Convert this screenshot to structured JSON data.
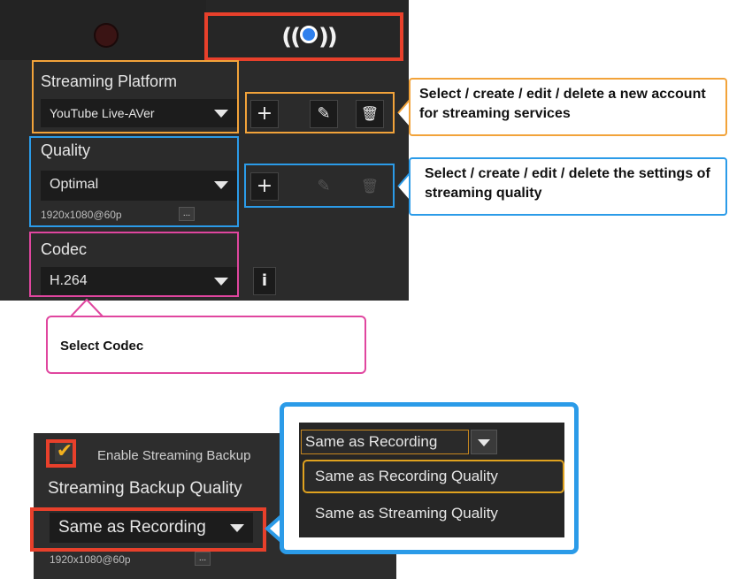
{
  "tabs": {
    "streaming_icon": "broadcast-icon"
  },
  "streaming_platform": {
    "label": "Streaming Platform",
    "value": "YouTube Live-AVer",
    "add": "+",
    "edit": "✎",
    "delete": "🗑"
  },
  "quality": {
    "label": "Quality",
    "value": "Optimal",
    "resolution": "1920x1080@60p",
    "more": "...",
    "add": "+",
    "edit": "✎",
    "delete": "🗑"
  },
  "codec": {
    "label": "Codec",
    "value": "H.264",
    "info": "i"
  },
  "callouts": {
    "platform": "Select / create / edit / delete a new account for streaming services",
    "quality": "Select / create / edit / delete the settings of streaming quality",
    "codec": "Select Codec"
  },
  "backup": {
    "checkbox_mark": "✔",
    "enable_label": "Enable Streaming Backup",
    "quality_label": "Streaming Backup Quality",
    "value": "Same as Recording",
    "resolution": "1920x1080@60p",
    "more": "...",
    "popup_selected": "Same as Recording",
    "options": [
      "Same as Recording Quality",
      "Same as Streaming Quality"
    ],
    "side_fragment": "1"
  },
  "colors": {
    "orange": "#f2a33a",
    "blue": "#2b9be8",
    "pink": "#e0469f",
    "red": "#e8402b",
    "checkmark": "#f2b01e"
  }
}
